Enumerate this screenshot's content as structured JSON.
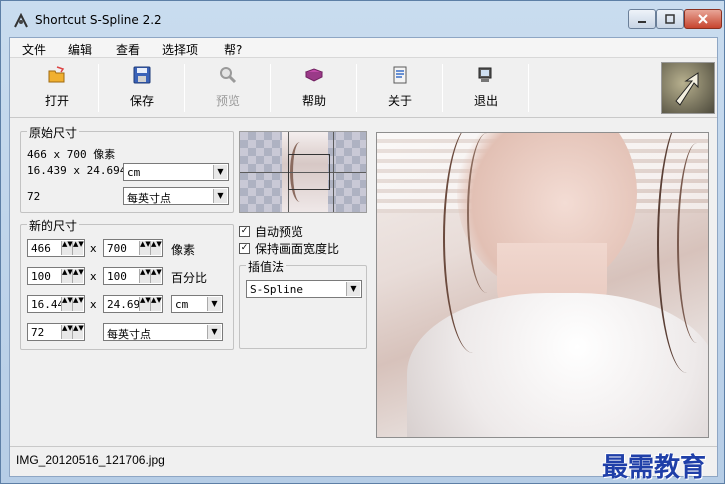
{
  "window": {
    "title": "Shortcut S-Spline 2.2"
  },
  "menu": [
    "文件",
    "编辑",
    "查看",
    "选择项",
    "帮?"
  ],
  "toolbar": {
    "open": "打开",
    "save": "保存",
    "preview": "预览",
    "help": "帮助",
    "about": "关于",
    "exit": "退出"
  },
  "original": {
    "title": "原始尺寸",
    "pixels": "466 x 700 像素",
    "size": "16.439 x 24.694",
    "size_unit": "cm",
    "resolution": "72",
    "resolution_unit": "每英寸点"
  },
  "newsize": {
    "title": "新的尺寸",
    "width_px": "466",
    "height_px": "700",
    "px_label": "像素",
    "width_pct": "100",
    "height_pct": "100",
    "pct_label": "百分比",
    "width_cm": "16.44",
    "height_cm": "24.69",
    "cm_unit": "cm",
    "resolution": "72",
    "resolution_unit": "每英寸点",
    "times": "x"
  },
  "options": {
    "auto_preview": "自动预览",
    "keep_ratio": "保持画面宽度比",
    "auto_preview_checked": true,
    "keep_ratio_checked": true
  },
  "interpolation": {
    "title": "插值法",
    "value": "S-Spline"
  },
  "status": {
    "filename": "IMG_20120516_121706.jpg"
  },
  "watermark": "最需教育",
  "icons": {
    "open": "folder-open-icon",
    "save": "floppy-disk-icon",
    "preview": "magnifier-icon",
    "help": "book-icon",
    "about": "info-document-icon",
    "exit": "exit-door-icon"
  }
}
